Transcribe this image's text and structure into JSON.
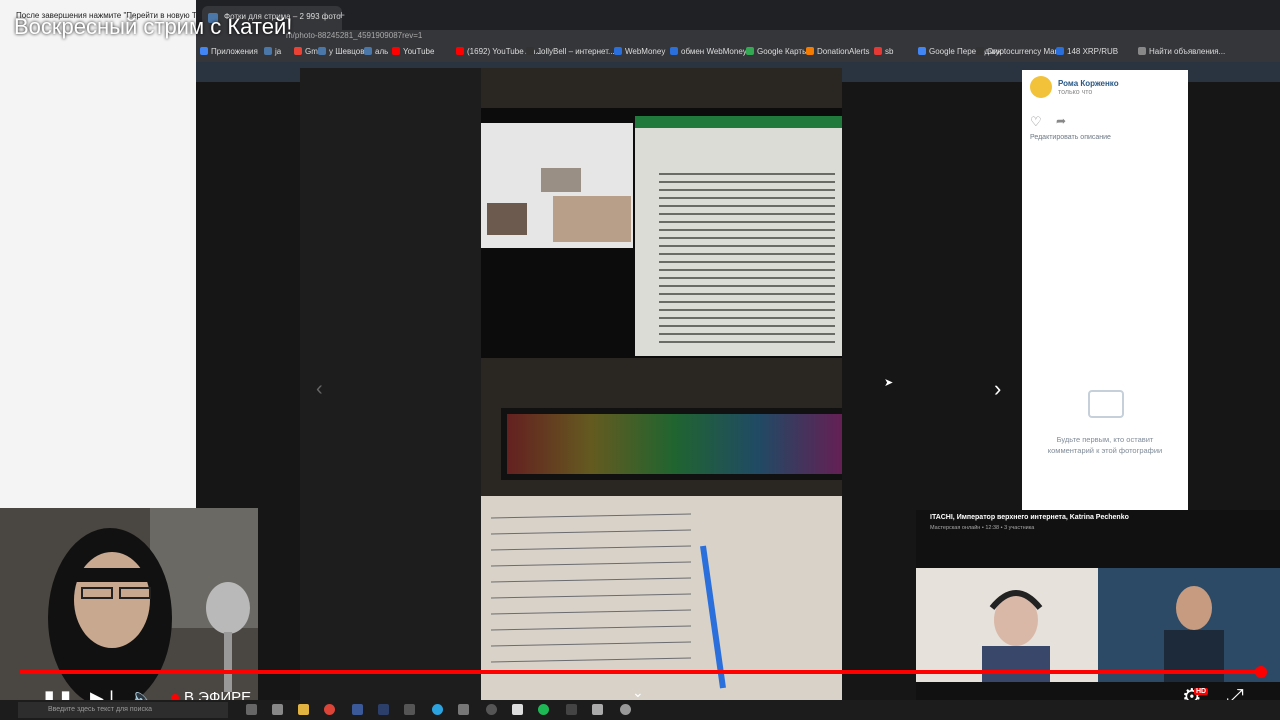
{
  "stream_title": "Воскресный стрим с Катей!",
  "left_hint": "После завершения нажмите \"Перейти в новую Творче",
  "browser": {
    "tabs": [
      {
        "label": "Фотки для стрима – 2 993 фото"
      }
    ],
    "url": "m/photo-88245281_4591909087rev=1",
    "bookmarks": [
      {
        "label": "Приложения",
        "color": "#4285f4"
      },
      {
        "label": "ja",
        "color": "#4a76a8"
      },
      {
        "label": "Gmail",
        "color": "#ea4335"
      },
      {
        "label": "у Шевцова",
        "color": "#4a76a8"
      },
      {
        "label": "аль",
        "color": "#4a76a8"
      },
      {
        "label": "YouTube",
        "color": "#ff0000"
      },
      {
        "label": "(1692) YouTube An...",
        "color": "#ff0000"
      },
      {
        "label": "JollyBell – интернет...",
        "color": "#333333"
      },
      {
        "label": "WebMoney",
        "color": "#2a6fdb"
      },
      {
        "label": "обмен WebMoney",
        "color": "#2a6fdb"
      },
      {
        "label": "Google Карты",
        "color": "#34a853"
      },
      {
        "label": "DonationAlerts",
        "color": "#f57c00"
      },
      {
        "label": "sb",
        "color": "#e53935"
      },
      {
        "label": "Google Переводчик",
        "color": "#4285f4"
      },
      {
        "label": "Cryptocurrency Mar...",
        "color": "#333333"
      },
      {
        "label": "148 XRP/RUB",
        "color": "#2a6fdb"
      },
      {
        "label": "Найти объявления...",
        "color": "#888888"
      }
    ]
  },
  "photo_viewer": {
    "author": "Рома Корженко",
    "time": "только что",
    "like_icon": "♡",
    "share_icon": "➦",
    "edit_label": "Редактировать описание",
    "comment_empty": "Будьте первым, кто оставит комментарий к этой фотографии",
    "prev_icon": "‹",
    "next_icon": "›"
  },
  "pip": {
    "title": "ITACHI, Император верхнего интернета, Katrina Pechenko",
    "subtitle": "Мастерская онлайн • 12:38 • 3 участника"
  },
  "player": {
    "progress": 1.0,
    "pause_icon": "❚❚",
    "skip_icon": "▶❘",
    "volume_icon": "🔈",
    "live_label": "В ЭФИРЕ",
    "settings_icon": "⚙",
    "hd_label": "HD",
    "exit_fullscreen_icon": "⤢",
    "chevron_icon": "⌄"
  },
  "taskbar": {
    "search_placeholder": "Введите здесь текст для поиска"
  }
}
